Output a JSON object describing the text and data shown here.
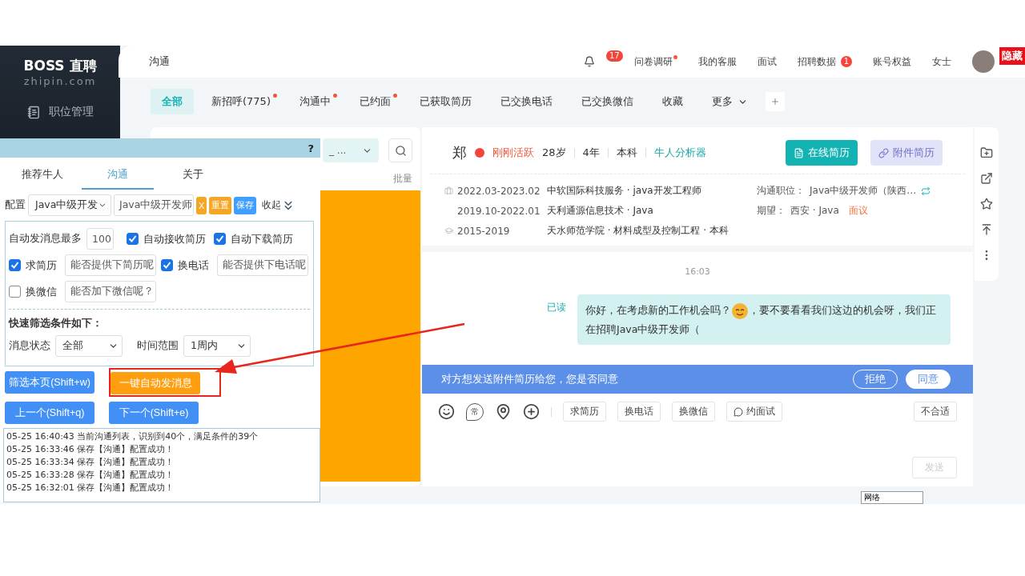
{
  "sidebar": {
    "logo": "BOSS 直聘",
    "domain": "zhipin.com",
    "items": [
      {
        "label": "职位管理"
      }
    ]
  },
  "header": {
    "title": "沟通",
    "notifications": "17",
    "items": [
      {
        "label": "问卷调研",
        "dot": true
      },
      {
        "label": "我的客服",
        "dot": false
      },
      {
        "label": "面试",
        "dot": false
      },
      {
        "label": "招聘数据",
        "dot": false,
        "badge": "1"
      },
      {
        "label": "账号权益",
        "dot": false
      },
      {
        "label": "女士",
        "dot": false
      }
    ],
    "hide_label": "隐藏"
  },
  "tabs": [
    {
      "label": "全部",
      "selected": true,
      "dot": false
    },
    {
      "label": "新招呼(775)",
      "selected": false,
      "dot": true
    },
    {
      "label": "沟通中",
      "selected": false,
      "dot": true
    },
    {
      "label": "已约面",
      "selected": false,
      "dot": true
    },
    {
      "label": "已获取简历",
      "selected": false,
      "dot": false
    },
    {
      "label": "已交换电话",
      "selected": false,
      "dot": false
    },
    {
      "label": "已交换微信",
      "selected": false,
      "dot": false
    },
    {
      "label": "收藏",
      "selected": false,
      "dot": false
    },
    {
      "label": "更多",
      "selected": false,
      "dot": false,
      "kind": "dropdown"
    }
  ],
  "chat_list": {
    "filter": "_ ...",
    "batch": "批量"
  },
  "candidate": {
    "name": "郑",
    "status": "刚刚活跃",
    "facts": [
      "28岁",
      "4年",
      "本科"
    ],
    "analyzer": "牛人分析器",
    "buttons": [
      {
        "label": "在线简历",
        "disabled": false
      },
      {
        "label": "附件简历",
        "disabled": true
      }
    ],
    "history": [
      {
        "kind": "job",
        "period": "2022.03-2023.02",
        "detail": "中软国际科技服务 · java开发工程师"
      },
      {
        "kind": "more",
        "period": "2019.10-2022.01",
        "detail": "天利通源信息技术 · Java"
      },
      {
        "kind": "school",
        "period": "2015-2019",
        "detail": "天水师范学院 · 材料成型及控制工程 · 本科"
      }
    ],
    "position": {
      "label": "沟通职位：",
      "value": "Java中级开发师（陕西…"
    },
    "expectation": {
      "label": "期望：",
      "value": "西安 · Java",
      "salary": "面议"
    }
  },
  "chat": {
    "time": "16:03",
    "messages": [
      {
        "status": "已读",
        "before": "你好，在考虑新的工作机会吗？",
        "after": "，要不要看看我们这边的机会呀，我们正在招聘Java中级开发师（"
      }
    ]
  },
  "request": {
    "text": "对方想发送附件简历给您，您是否同意",
    "buttons": [
      {
        "label": "拒绝",
        "kind": "outline"
      },
      {
        "label": "同意",
        "kind": "solid"
      }
    ]
  },
  "composer": {
    "common": "常",
    "quick": [
      {
        "label": "求简历",
        "kind": "plain"
      },
      {
        "label": "换电话",
        "kind": "plain"
      },
      {
        "label": "换微信",
        "kind": "plain"
      },
      {
        "label": "约面试",
        "kind": "chat"
      }
    ],
    "reject": "不合适",
    "send": {
      "label": "发送",
      "disabled": true
    }
  },
  "network": "网络",
  "assistant": {
    "help": "?",
    "tabs": [
      {
        "label": "推荐牛人",
        "selected": false
      },
      {
        "label": "沟通",
        "selected": true
      },
      {
        "label": "关于",
        "selected": false
      }
    ],
    "config": {
      "label": "配置",
      "profile": "Java中级开发",
      "name": "Java中级开发师",
      "buttons": [
        {
          "label": "X",
          "kind": "warn"
        },
        {
          "label": "重置",
          "kind": "warn"
        },
        {
          "label": "保存",
          "kind": "info"
        }
      ],
      "collapse": "收起"
    },
    "settings": {
      "max_label": "自动发消息最多",
      "max_value": "100",
      "options": [
        {
          "label": "自动接收简历",
          "checked": true
        },
        {
          "label": "自动下载简历",
          "checked": true
        }
      ],
      "requests": [
        {
          "label": "求简历",
          "checked": true,
          "message": "能否提供下简历呢"
        },
        {
          "label": "换电话",
          "checked": true,
          "message": "能否提供下电话呢"
        },
        {
          "label": "换微信",
          "checked": false,
          "message": "能否加下微信呢？"
        }
      ],
      "filter_title": "快速筛选条件如下：",
      "filters": [
        {
          "label": "消息状态",
          "value": "全部"
        },
        {
          "label": "时间范围",
          "value": "1周内"
        }
      ]
    },
    "actions": [
      {
        "label": "筛选本页(Shift+w)",
        "kind": "primary",
        "highlighted": false
      },
      {
        "label": "一键自动发消息",
        "kind": "accent",
        "highlighted": true
      },
      {
        "label": "上一个(Shift+q)",
        "kind": "primary",
        "highlighted": false
      },
      {
        "label": "下一个(Shift+e)",
        "kind": "primary",
        "highlighted": false
      }
    ],
    "log": [
      "05-25 16:40:43 当前沟通列表，识别到40个，满足条件的39个",
      "05-25 16:33:46 保存【沟通】配置成功！",
      "05-25 16:33:34 保存【沟通】配置成功！",
      "05-25 16:33:28 保存【沟通】配置成功！",
      "05-25 16:32:01 保存【沟通】配置成功！"
    ]
  }
}
